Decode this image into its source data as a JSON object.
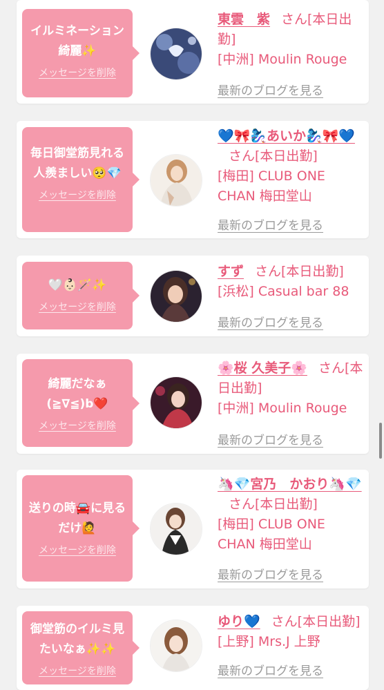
{
  "cards": [
    {
      "message": "イルミネーション\n綺麗✨",
      "delete_label": "メッセージを削除",
      "name": "東雲　紫",
      "suffix": "さん[本日出勤]",
      "shop": "[中洲] Moulin Rouge",
      "blog_link": "最新のブログを見る"
    },
    {
      "message": "毎日御堂筋見れる\n人羨ましい🥺💎",
      "delete_label": "メッセージを削除",
      "name": "💙🎀🧞‍♀️あいか🧞‍♀️🎀💙",
      "suffix": "さん[本日出勤]",
      "shop": "[梅田] CLUB ONE CHAN 梅田堂山",
      "blog_link": "最新のブログを見る"
    },
    {
      "message": "🤍👶🏻🪄✨",
      "delete_label": "メッセージを削除",
      "name": "すず",
      "suffix": "さん[本日出勤]",
      "shop": "[浜松] Casual bar 88",
      "blog_link": "最新のブログを見る"
    },
    {
      "message": "綺麗だなぁ\n(≧∇≦)b❤️",
      "delete_label": "メッセージを削除",
      "name": "🌸桜 久美子🌸",
      "suffix": "さん[本日出勤]",
      "shop": "[中洲] Moulin Rouge",
      "blog_link": "最新のブログを見る"
    },
    {
      "message": "送りの時🚘に見る\nだけ🙋",
      "delete_label": "メッセージを削除",
      "name": "🦄💎宮乃　かおり🦄💎",
      "suffix": "さん[本日出勤]",
      "shop": "[梅田] CLUB ONE CHAN 梅田堂山",
      "blog_link": "最新のブログを見る"
    },
    {
      "message": "御堂筋のイルミ見\nたいなぁ✨✨",
      "delete_label": "メッセージを削除",
      "name": "ゆり💙",
      "suffix": "さん[本日出勤]",
      "shop": "[上野] Mrs.J 上野",
      "blog_link": "最新のブログを見る"
    }
  ],
  "colors": {
    "accent": "#e85a7a",
    "bubble": "#f59aac",
    "link_gray": "#9a9a9a",
    "background": "#f1f1f1"
  }
}
